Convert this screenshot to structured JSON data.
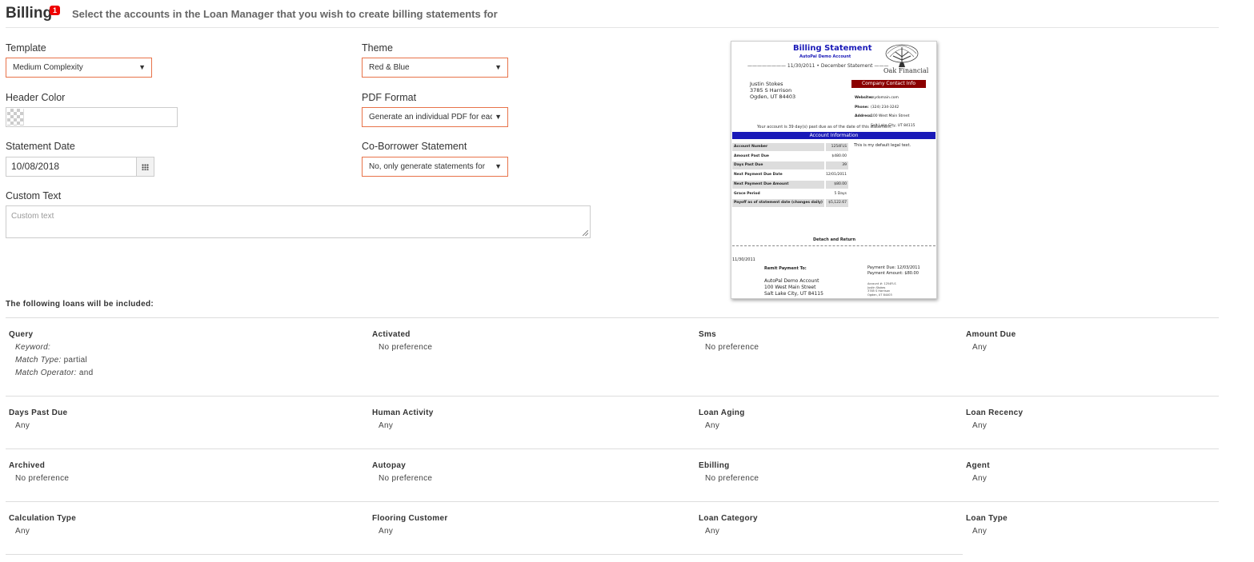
{
  "header": {
    "title": "Billing",
    "badge": "1",
    "subtitle": "Select the accounts in the Loan Manager that you wish to create billing statements for"
  },
  "form": {
    "template": {
      "label": "Template",
      "value": "Medium Complexity"
    },
    "theme": {
      "label": "Theme",
      "value": "Red & Blue"
    },
    "header_color": {
      "label": "Header Color",
      "value": ""
    },
    "pdf_format": {
      "label": "PDF Format",
      "value": "Generate an individual PDF for each"
    },
    "statement_date": {
      "label": "Statement Date",
      "value": "10/08/2018"
    },
    "co_borrower": {
      "label": "Co-Borrower Statement",
      "value": "No, only generate statements for"
    },
    "custom_text": {
      "label": "Custom Text",
      "placeholder": "Custom text"
    }
  },
  "preview": {
    "title": "Billing Statement",
    "subtitle": "AutoPal Demo Account",
    "date_line": "———————— 11/30/2011 • December Statement ———",
    "brand": "Oak Financial",
    "borrower": [
      "Justin Stokes",
      "3785 S Harrison",
      "Ogden, UT 84403"
    ],
    "contact_header": "Company Contact Info",
    "contact": [
      {
        "k": "Website:",
        "v": "mydomain.com"
      },
      {
        "k": "Phone:",
        "v": "(324) 234-3242"
      },
      {
        "k": "Address:",
        "v": "100 West Main Street"
      },
      {
        "k": "",
        "v": "Salt Lake City, UT 84115"
      }
    ],
    "notice": "Your account is 39 day(s) past due as of the date of this statement.",
    "account_header": "Account Information",
    "account_rows": [
      {
        "k": "Account Number",
        "v": "1254FLS"
      },
      {
        "k": "Amount Past Due",
        "v": "$480.00"
      },
      {
        "k": "Days Past Due",
        "v": "39"
      },
      {
        "k": "Next Payment Due Date",
        "v": "12/01/2011"
      },
      {
        "k": "Next Payment Due Amount",
        "v": "$80.00"
      },
      {
        "k": "Grace Period",
        "v": "5 Days"
      },
      {
        "k": "Payoff as of statement date (changes daily)",
        "v": "$5,122.67"
      }
    ],
    "legal": "This is my default legal text.",
    "detach": "Detach and Return",
    "stub_date": "11/30/2011",
    "remit_label": "Remit Payment To:",
    "payment_due": "Payment Due: 12/03/2011",
    "payment_amount": "Payment Amount: $80.00",
    "remit_address": [
      "AutoPal Demo Account",
      "100 West Main Street",
      "Salt Lake City, UT 84115"
    ],
    "stub_account": [
      "Account #: 1254FLS",
      "Justin Stokes",
      "3785 S Harrison",
      "Ogden, UT 84403"
    ]
  },
  "included_label": "The following loans will be included:",
  "filters": [
    {
      "name": "Query",
      "query": {
        "keyword_label": "Keyword:",
        "keyword_value": "",
        "match_type_label": "Match Type:",
        "match_type_value": "partial",
        "match_operator_label": "Match Operator:",
        "match_operator_value": "and"
      }
    },
    {
      "name": "Activated",
      "value": "No preference"
    },
    {
      "name": "Sms",
      "value": "No preference"
    },
    {
      "name": "Amount Due",
      "value": "Any"
    },
    {
      "name": "Days Past Due",
      "value": "Any"
    },
    {
      "name": "Human Activity",
      "value": "Any"
    },
    {
      "name": "Loan Aging",
      "value": "Any"
    },
    {
      "name": "Loan Recency",
      "value": "Any"
    },
    {
      "name": "Archived",
      "value": "No preference"
    },
    {
      "name": "Autopay",
      "value": "No preference"
    },
    {
      "name": "Ebilling",
      "value": "No preference"
    },
    {
      "name": "Agent",
      "value": "Any"
    },
    {
      "name": "Calculation Type",
      "value": "Any"
    },
    {
      "name": "Flooring Customer",
      "value": "Any"
    },
    {
      "name": "Loan Category",
      "value": "Any"
    },
    {
      "name": "Loan Type",
      "value": "Any"
    }
  ]
}
